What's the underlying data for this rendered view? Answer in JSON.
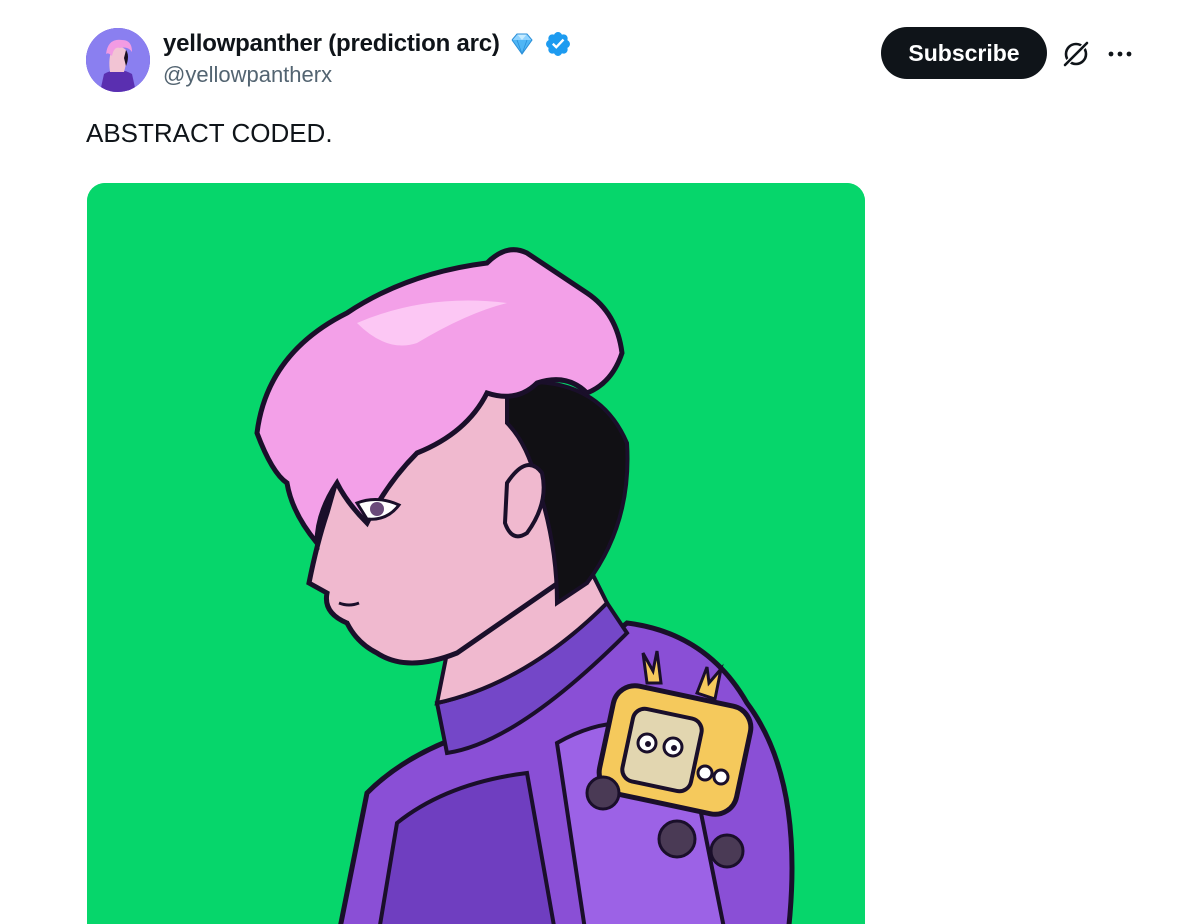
{
  "post": {
    "author": {
      "display_name": "yellowpanther (prediction arc)",
      "handle": "@yellowpantherx",
      "badges": [
        "diamond-icon",
        "verified-badge-icon"
      ],
      "avatar": "avatar-pink-hair-character"
    },
    "actions": {
      "subscribe_label": "Subscribe",
      "icons": [
        "grok-icon",
        "more-icon"
      ]
    },
    "text": "ABSTRACT CODED.",
    "media": {
      "kind": "illustration",
      "background_color": "#06d66b"
    }
  },
  "colors": {
    "text_primary": "#0f1419",
    "text_secondary": "#536471",
    "verified_blue": "#1d9bf0",
    "button_bg": "#0f1419",
    "media_bg": "#06d66b",
    "hair_pink": "#f3a0e8",
    "suit_purple": "#8a4fd6"
  }
}
